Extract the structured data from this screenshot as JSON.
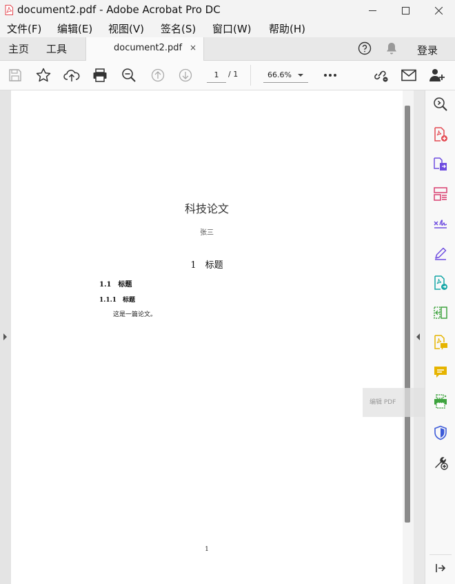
{
  "window": {
    "title": "document2.pdf - Adobe Acrobat Pro DC"
  },
  "menu": [
    "文件(F)",
    "编辑(E)",
    "视图(V)",
    "签名(S)",
    "窗口(W)",
    "帮助(H)"
  ],
  "tabs": {
    "home": "主页",
    "tools": "工具",
    "document": "document2.pdf",
    "close": "×",
    "login": "登录"
  },
  "toolbar": {
    "page_current": "1",
    "page_total": "/ 1",
    "zoom": "66.6%"
  },
  "page": {
    "title": "科技论文",
    "author": "张三",
    "section": "1　标题",
    "subsection": "1.1　标题",
    "subsubsection": "1.1.1　标题",
    "body": "这是一篇论文。",
    "page_number": "1"
  },
  "tooltip": "编辑 PDF",
  "colors": {
    "accent_red": "#e34850",
    "accent_purple": "#6e4ce0",
    "accent_pink": "#d93e6f",
    "accent_teal": "#12a5a5",
    "accent_green": "#3ea33e",
    "accent_yellow": "#e6b400",
    "accent_blue": "#3c5ad8"
  }
}
